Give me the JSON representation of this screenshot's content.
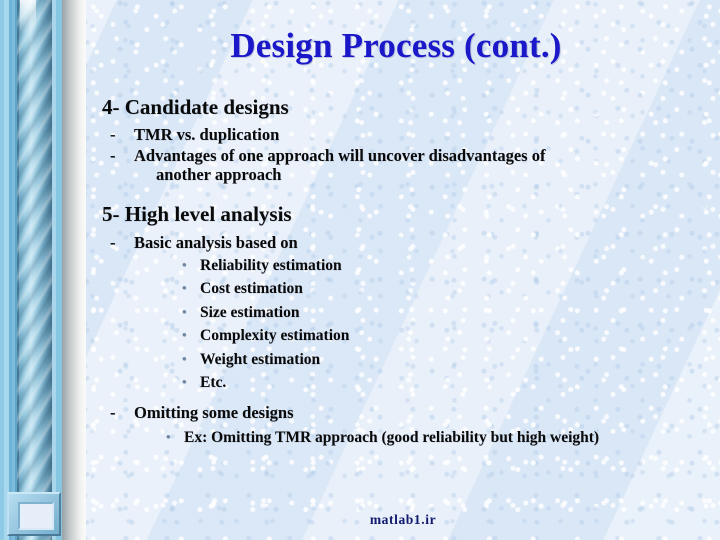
{
  "slide": {
    "title": "Design Process (cont.)",
    "footer": "matlab1.ir",
    "colors": {
      "title": "#1a18c8",
      "body_text": "#0a0a0a",
      "footer": "#111a6e",
      "background": "#dfeaf8",
      "sidebar_pillar": "#8dc2da",
      "bullet_dot": "#6e86a4"
    },
    "sections": [
      {
        "heading": "4- Candidate designs",
        "items": [
          {
            "dash": "-",
            "text": "TMR vs. duplication"
          },
          {
            "dash": "-",
            "text": "Advantages of one approach will uncover disadvantages of",
            "text_line2": "another approach"
          }
        ]
      },
      {
        "heading": "5- High level analysis",
        "items": [
          {
            "dash": "-",
            "text": "Basic analysis based on"
          }
        ],
        "subitems": [
          {
            "bullet": "•",
            "text": "Reliability estimation"
          },
          {
            "bullet": "•",
            "text": "Cost estimation"
          },
          {
            "bullet": "•",
            "text": "Size estimation"
          },
          {
            "bullet": "•",
            "text": "Complexity estimation"
          },
          {
            "bullet": "•",
            "text": "Weight estimation"
          },
          {
            "bullet": "•",
            "text": "Etc."
          }
        ],
        "items2": [
          {
            "dash": "-",
            "text": "Omitting some designs"
          }
        ],
        "subitems2": [
          {
            "bullet": "•",
            "text": "Ex: Omitting TMR approach (good reliability but high weight)"
          }
        ]
      }
    ]
  }
}
